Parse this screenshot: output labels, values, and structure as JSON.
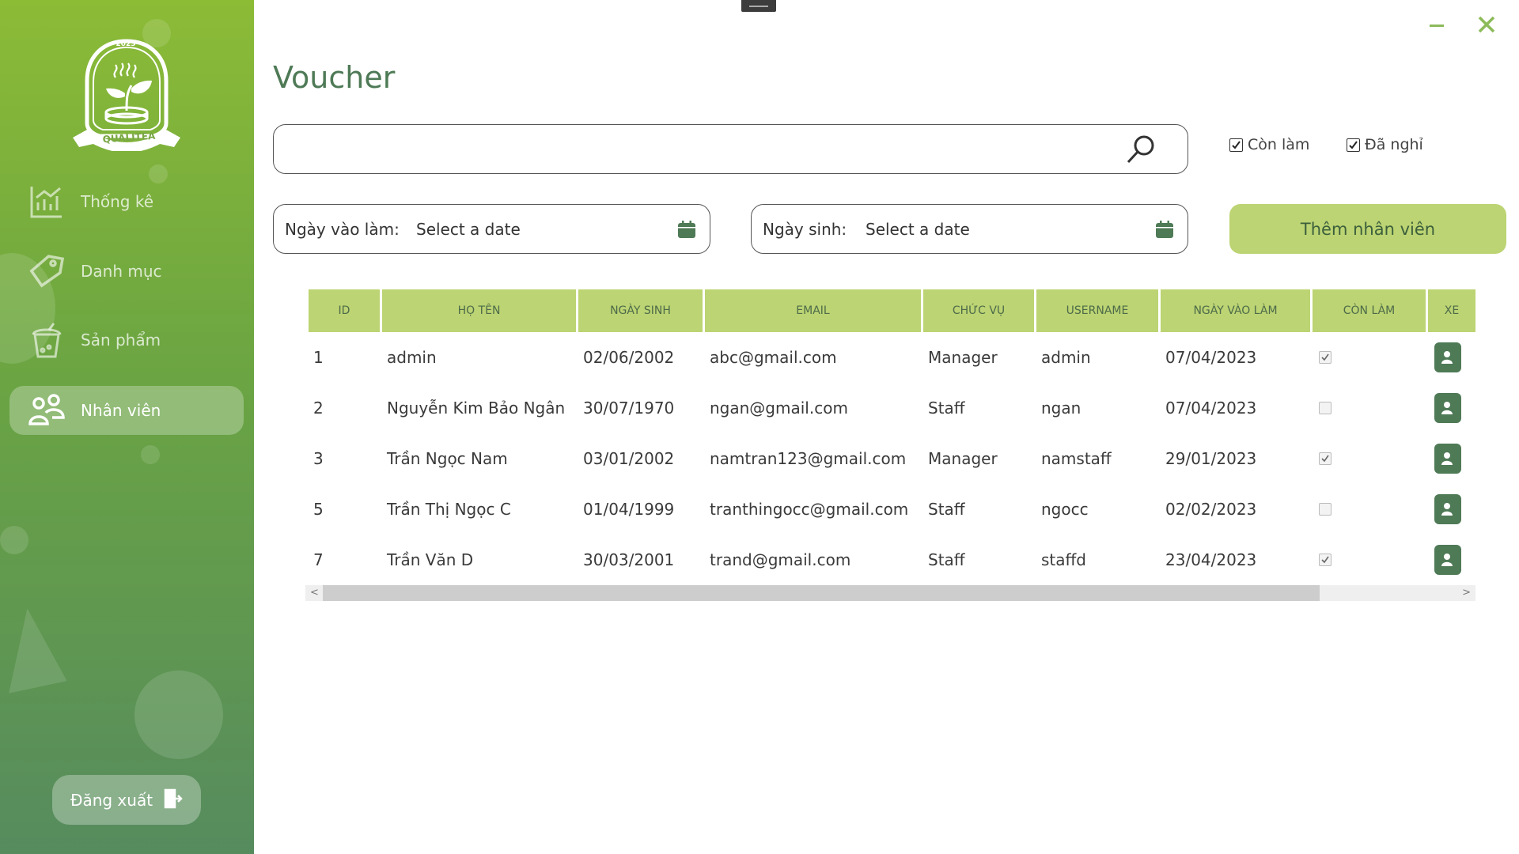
{
  "app": {
    "logo_text": "QUALITEA",
    "logo_year": "2023"
  },
  "sidebar": {
    "items": [
      {
        "label": "Thống kê",
        "icon": "chart-icon",
        "active": false
      },
      {
        "label": "Danh mục",
        "icon": "tag-icon",
        "active": false
      },
      {
        "label": "Sản phẩm",
        "icon": "drink-cup-icon",
        "active": false
      },
      {
        "label": "Nhân viên",
        "icon": "users-icon",
        "active": true
      }
    ],
    "logout_label": "Đăng xuất"
  },
  "page": {
    "title": "Voucher"
  },
  "search": {
    "value": "",
    "placeholder": ""
  },
  "filters": {
    "still_working_label": "Còn làm",
    "still_working_checked": true,
    "quit_label": "Đã nghỉ",
    "quit_checked": true,
    "start_date_label": "Ngày vào làm:",
    "start_date_value": "Select a date",
    "birthday_label": "Ngày sinh:",
    "birthday_value": "Select a date"
  },
  "add_button_label": "Thêm nhân viên",
  "table": {
    "columns": [
      "ID",
      "HỌ TÊN",
      "NGÀY SINH",
      "EMAIL",
      "CHỨC VỤ",
      "USERNAME",
      "NGÀY VÀO LÀM",
      "CÒN LÀM",
      "XE"
    ],
    "rows": [
      {
        "id": "1",
        "name": "admin",
        "dob": "02/06/2002",
        "email": "abc@gmail.com",
        "role": "Manager",
        "username": "admin",
        "start": "07/04/2023",
        "active": true
      },
      {
        "id": "2",
        "name": "Nguyễn Kim Bảo Ngân",
        "dob": "30/07/1970",
        "email": "ngan@gmail.com",
        "role": "Staff",
        "username": "ngan",
        "start": "07/04/2023",
        "active": false
      },
      {
        "id": "3",
        "name": "Trần Ngọc Nam",
        "dob": "03/01/2002",
        "email": "namtran123@gmail.com",
        "role": "Manager",
        "username": "namstaff",
        "start": "29/01/2023",
        "active": true
      },
      {
        "id": "5",
        "name": "Trần Thị Ngọc C",
        "dob": "01/04/1999",
        "email": "tranthingocc@gmail.com",
        "role": "Staff",
        "username": "ngocc",
        "start": "02/02/2023",
        "active": false
      },
      {
        "id": "7",
        "name": "Trần Văn D",
        "dob": "30/03/2001",
        "email": "trand@gmail.com",
        "role": "Staff",
        "username": "staffd",
        "start": "23/04/2023",
        "active": true
      }
    ]
  },
  "colors": {
    "accent_green": "#bcd473",
    "dark_green": "#4e7a56"
  }
}
